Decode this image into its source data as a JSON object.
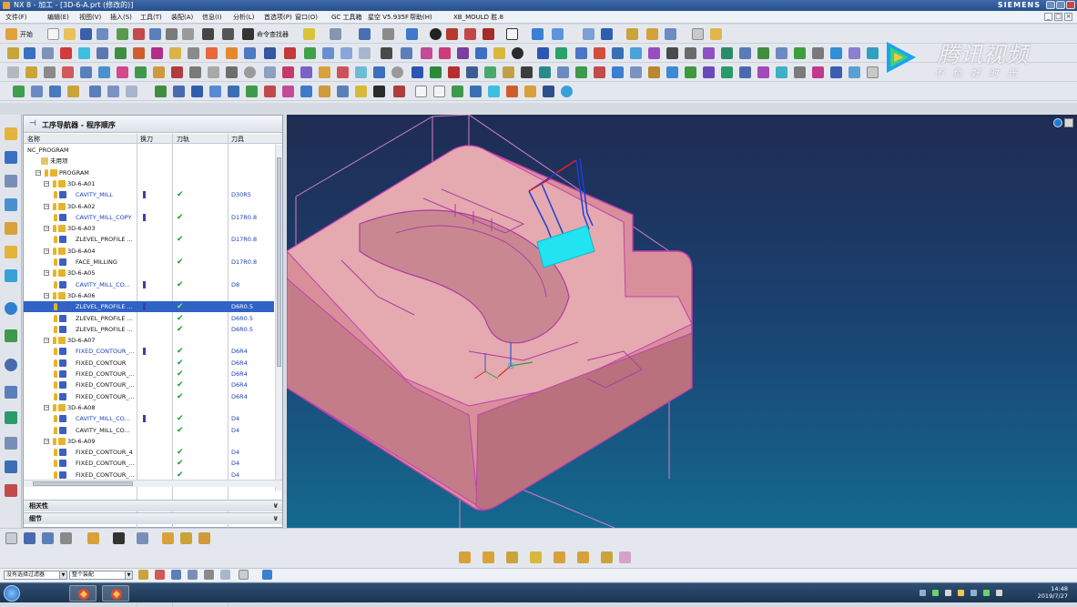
{
  "window": {
    "title": "NX 8 - 加工 - [3D-6-A.prt (修改的)]",
    "brand": "SIEMENS"
  },
  "menu": [
    "文件(F)",
    "编辑(E)",
    "视图(V)",
    "插入(S)",
    "工具(T)",
    "装配(A)",
    "信息(I)",
    "分析(L)",
    "首选项(P)",
    "窗口(O)",
    "GC 工具箱",
    "星空 V5.935F",
    "帮助(H)",
    "XB_MOULD 胜.8"
  ],
  "toolbar": {
    "start_label": "开始",
    "command_finder_label": "命令查找器"
  },
  "watermark": {
    "main": "腾讯视频",
    "sub": "不负好时光"
  },
  "navigator": {
    "title": "工序导航器 - 程序顺序",
    "columns": [
      "名称",
      "换刀",
      "刀轨",
      "刀具"
    ],
    "rows": [
      {
        "indent": 0,
        "name": "NC_PROGRAM",
        "kind": "root",
        "tool": "",
        "bar": false,
        "check": false,
        "selected": false
      },
      {
        "indent": 1,
        "name": "未用项",
        "kind": "folder",
        "tool": "",
        "bar": false,
        "check": false,
        "selected": false
      },
      {
        "indent": 1,
        "name": "PROGRAM",
        "kind": "program",
        "tool": "",
        "bar": false,
        "check": false,
        "selected": false
      },
      {
        "indent": 2,
        "name": "3D-6-A01",
        "kind": "program",
        "tool": "",
        "bar": false,
        "check": false,
        "selected": false
      },
      {
        "indent": 3,
        "name": "CAVITY_MILL",
        "kind": "op-blue",
        "tool": "D30R5",
        "bar": true,
        "check": true,
        "selected": false
      },
      {
        "indent": 2,
        "name": "3D-6-A02",
        "kind": "program",
        "tool": "",
        "bar": false,
        "check": false,
        "selected": false
      },
      {
        "indent": 3,
        "name": "CAVITY_MILL_COPY",
        "kind": "op-blue",
        "tool": "D17R0.8",
        "bar": true,
        "check": true,
        "selected": false
      },
      {
        "indent": 2,
        "name": "3D-6-A03",
        "kind": "program",
        "tool": "",
        "bar": false,
        "check": false,
        "selected": false
      },
      {
        "indent": 3,
        "name": "ZLEVEL_PROFILE ...",
        "kind": "op",
        "tool": "D17R0.8",
        "bar": false,
        "check": true,
        "selected": false
      },
      {
        "indent": 2,
        "name": "3D-6-A04",
        "kind": "program",
        "tool": "",
        "bar": false,
        "check": false,
        "selected": false
      },
      {
        "indent": 3,
        "name": "FACE_MILLING",
        "kind": "op",
        "tool": "D17R0.8",
        "bar": false,
        "check": true,
        "selected": false
      },
      {
        "indent": 2,
        "name": "3D-6-A05",
        "kind": "program",
        "tool": "",
        "bar": false,
        "check": false,
        "selected": false
      },
      {
        "indent": 3,
        "name": "CAVITY_MILL_CO...",
        "kind": "op-blue",
        "tool": "D8",
        "bar": true,
        "check": true,
        "selected": false
      },
      {
        "indent": 2,
        "name": "3D-6-A06",
        "kind": "program",
        "tool": "",
        "bar": false,
        "check": false,
        "selected": false
      },
      {
        "indent": 3,
        "name": "ZLEVEL_PROFILE ...",
        "kind": "op-blue",
        "tool": "D6R0.5",
        "bar": true,
        "check": true,
        "selected": true
      },
      {
        "indent": 3,
        "name": "ZLEVEL_PROFILE ...",
        "kind": "op",
        "tool": "D6R0.5",
        "bar": false,
        "check": true,
        "selected": false
      },
      {
        "indent": 3,
        "name": "ZLEVEL_PROFILE ...",
        "kind": "op",
        "tool": "D6R0.5",
        "bar": false,
        "check": true,
        "selected": false
      },
      {
        "indent": 2,
        "name": "3D-6-A07",
        "kind": "program",
        "tool": "",
        "bar": false,
        "check": false,
        "selected": false
      },
      {
        "indent": 3,
        "name": "FIXED_CONTOUR_...",
        "kind": "op-blue",
        "tool": "D6R4",
        "bar": true,
        "check": true,
        "selected": false
      },
      {
        "indent": 3,
        "name": "FIXED_CONTOUR",
        "kind": "op",
        "tool": "D6R4",
        "bar": false,
        "check": true,
        "selected": false
      },
      {
        "indent": 3,
        "name": "FIXED_CONTOUR_...",
        "kind": "op",
        "tool": "D6R4",
        "bar": false,
        "check": true,
        "selected": false
      },
      {
        "indent": 3,
        "name": "FIXED_CONTOUR_...",
        "kind": "op",
        "tool": "D6R4",
        "bar": false,
        "check": true,
        "selected": false
      },
      {
        "indent": 3,
        "name": "FIXED_CONTOUR_...",
        "kind": "op",
        "tool": "D6R4",
        "bar": false,
        "check": true,
        "selected": false
      },
      {
        "indent": 2,
        "name": "3D-6-A08",
        "kind": "program",
        "tool": "",
        "bar": false,
        "check": false,
        "selected": false
      },
      {
        "indent": 3,
        "name": "CAVITY_MILL_CO...",
        "kind": "op-blue",
        "tool": "D4",
        "bar": true,
        "check": true,
        "selected": false
      },
      {
        "indent": 3,
        "name": "CAVITY_MILL_CO...",
        "kind": "op",
        "tool": "D4",
        "bar": false,
        "check": true,
        "selected": false
      },
      {
        "indent": 2,
        "name": "3D-6-A09",
        "kind": "program",
        "tool": "",
        "bar": false,
        "check": false,
        "selected": false
      },
      {
        "indent": 3,
        "name": "FIXED_CONTOUR_4",
        "kind": "op",
        "tool": "D4",
        "bar": false,
        "check": true,
        "selected": false
      },
      {
        "indent": 3,
        "name": "FIXED_CONTOUR_...",
        "kind": "op",
        "tool": "D4",
        "bar": false,
        "check": true,
        "selected": false
      },
      {
        "indent": 3,
        "name": "FIXED_CONTOUR_...",
        "kind": "op",
        "tool": "D4",
        "bar": false,
        "check": true,
        "selected": false
      }
    ],
    "panels": [
      "相关性",
      "细节"
    ]
  },
  "status": {
    "filter_label": "没有选择过滤器",
    "assembly_label": "整个装配"
  },
  "taskbar": {
    "time": "14:48",
    "date": "2019/7/27"
  },
  "colors": {
    "part_body": "#d98f9a",
    "part_edge": "#c23fb0",
    "toolpath": "#1f3fd6",
    "highlight_face": "#22e3f0",
    "selected_row": "#2f63c6"
  }
}
